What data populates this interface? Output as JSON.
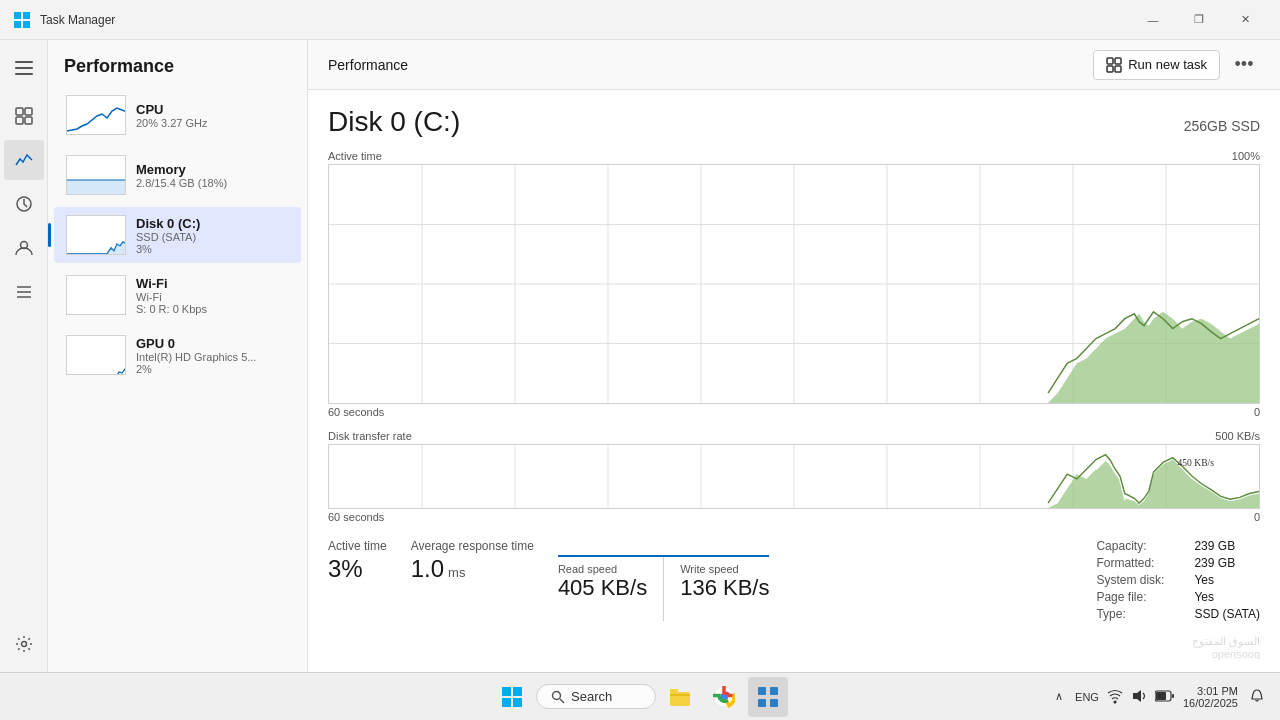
{
  "titlebar": {
    "icon": "⊞",
    "title": "Task Manager",
    "minimize": "—",
    "maximize": "❐",
    "close": "✕"
  },
  "iconsidebar": {
    "items": [
      {
        "name": "hamburger-icon",
        "icon": "☰"
      },
      {
        "name": "processes-icon",
        "icon": "▦"
      },
      {
        "name": "performance-icon",
        "icon": "📈"
      },
      {
        "name": "apphistory-icon",
        "icon": "🕐"
      },
      {
        "name": "users-icon",
        "icon": "👤"
      },
      {
        "name": "details-icon",
        "icon": "☰"
      },
      {
        "name": "settings-icon",
        "icon": "⚙"
      }
    ]
  },
  "leftpanel": {
    "title": "Performance",
    "devices": [
      {
        "name": "CPU",
        "sub1": "20%  3.27 GHz",
        "sub2": ""
      },
      {
        "name": "Memory",
        "sub1": "2.8/15.4 GB (18%)",
        "sub2": ""
      },
      {
        "name": "Disk 0 (C:)",
        "sub1": "SSD (SATA)",
        "sub2": "3%"
      },
      {
        "name": "Wi-Fi",
        "sub1": "Wi-Fi",
        "sub2": "S: 0  R: 0 Kbps"
      },
      {
        "name": "GPU 0",
        "sub1": "Intel(R) HD Graphics 5...",
        "sub2": "2%"
      }
    ]
  },
  "header": {
    "title": "Performance",
    "run_new_task": "Run new task",
    "more": "•••"
  },
  "disk": {
    "title": "Disk 0 (C:)",
    "spec": "256GB SSD",
    "active_time_label": "Active time",
    "active_time_max": "100%",
    "seconds_label": "60 seconds",
    "active_time_zero": "0",
    "transfer_rate_label": "Disk transfer rate",
    "transfer_rate_max": "500 KB/s",
    "transfer_seconds": "60 seconds",
    "transfer_zero": "0",
    "stats": {
      "active_time": {
        "label": "Active time",
        "value": "3%"
      },
      "avg_response": {
        "label": "Average response time",
        "value": "1.0",
        "unit": "ms"
      },
      "capacity_label": "Capacity:",
      "capacity_value": "239 GB",
      "formatted_label": "Formatted:",
      "formatted_value": "239 GB",
      "systemdisk_label": "System disk:",
      "systemdisk_value": "Yes",
      "pagefile_label": "Page file:",
      "pagefile_value": "Yes",
      "type_label": "Type:",
      "type_value": "SSD (SATA)",
      "read_speed_label": "Read speed",
      "read_speed_value": "405 KB/s",
      "write_speed_label": "Write speed",
      "write_speed_value": "136 KB/s"
    }
  },
  "taskbar": {
    "start_icon": "⊞",
    "search_label": "Search",
    "search_icon": "🔍",
    "file_explorer_icon": "📁",
    "chrome_icon": "⊙",
    "taskmanager_icon": "▦",
    "time": "3:01 PM",
    "date": "16/02/2025",
    "eng": "ENG",
    "chevron_up": "∧",
    "wifi_icon": "wifi",
    "volume_icon": "vol",
    "battery_icon": "bat"
  }
}
